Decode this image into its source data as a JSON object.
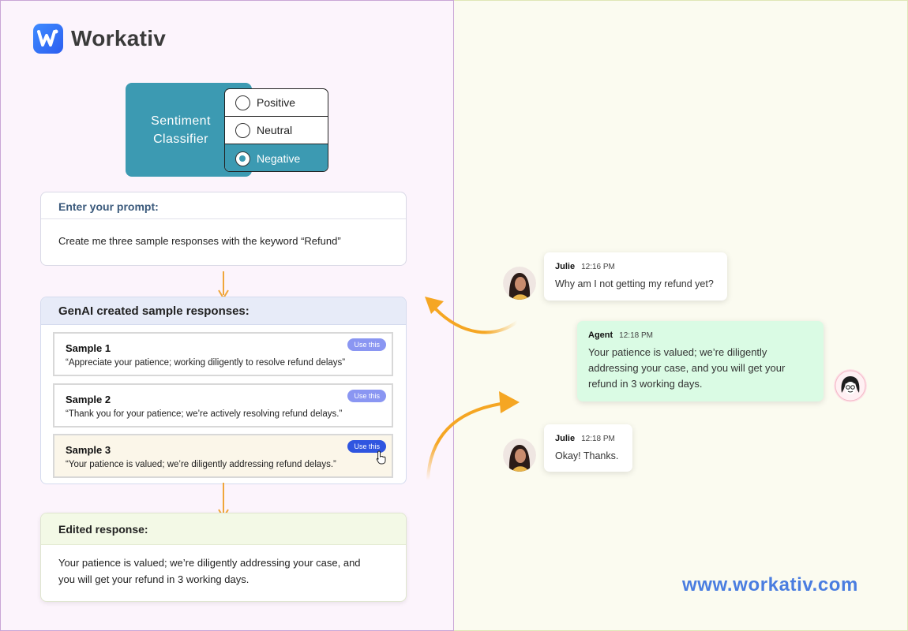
{
  "brand": {
    "name": "Workativ",
    "website": "www.workativ.com",
    "accent": "#2c5ef0"
  },
  "classifier": {
    "label": "Sentiment Classifier",
    "options": [
      {
        "label": "Positive",
        "selected": false
      },
      {
        "label": "Neutral",
        "selected": false
      },
      {
        "label": "Negative",
        "selected": true
      }
    ]
  },
  "prompt": {
    "heading": "Enter your prompt:",
    "text": "Create me three sample responses with the keyword “Refund”"
  },
  "samples": {
    "heading": "GenAI created sample responses:",
    "items": [
      {
        "title": "Sample 1",
        "text": "“Appreciate your patience; working diligently to resolve refund delays”",
        "button": "Use this"
      },
      {
        "title": "Sample 2",
        "text": "“Thank you for your patience; we’re actively resolving refund delays.”",
        "button": "Use this"
      },
      {
        "title": "Sample 3",
        "text": "“Your patience is valued; we’re diligently addressing refund delays.”",
        "button": "Use this"
      }
    ]
  },
  "edited": {
    "heading": "Edited response:",
    "line1": "Your patience is valued; we’re diligently addressing your case, and",
    "line2": "you will get your refund in 3 working days."
  },
  "chat": {
    "messages": [
      {
        "sender": "Julie",
        "time": "12:16 PM",
        "text": "Why am I not getting my refund yet?"
      },
      {
        "sender": "Agent",
        "time": "12:18 PM",
        "line1": "Your patience is valued; we’re diligently",
        "line2": "addressing your case, and you will get your",
        "line3": "refund in 3 working days."
      },
      {
        "sender": "Julie",
        "time": "12:18 PM",
        "text": "Okay! Thanks."
      }
    ]
  }
}
